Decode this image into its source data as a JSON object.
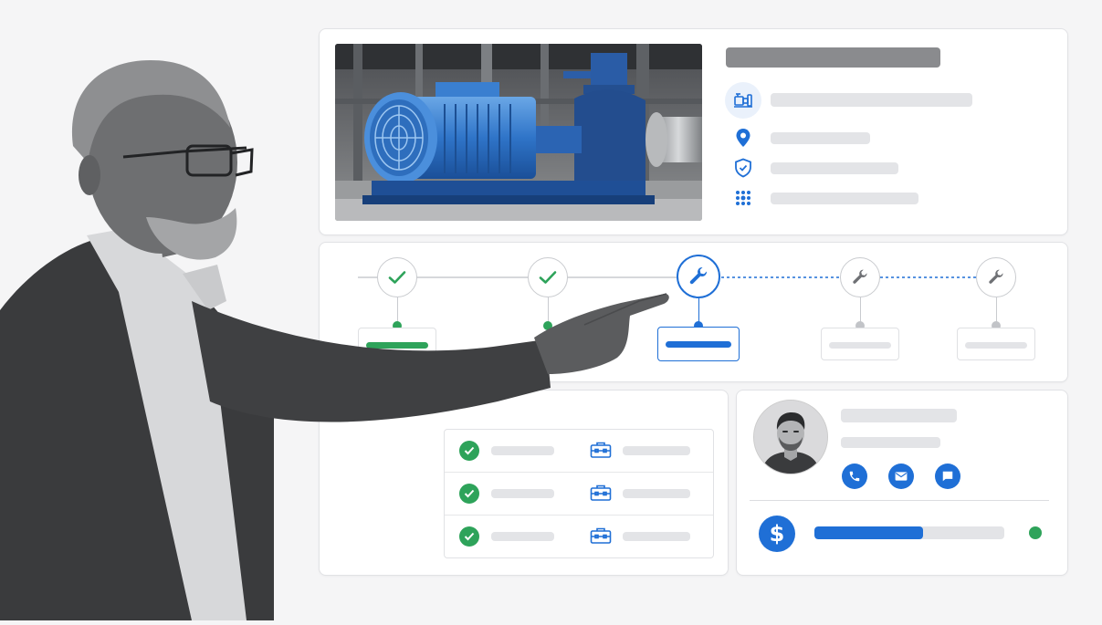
{
  "colors": {
    "accent": "#1f6fd6",
    "success": "#2ea35a",
    "placeholder": "#e3e4e7",
    "heading_placeholder": "#8a8b8e"
  },
  "asset_card": {
    "image": "industrial-pump-photo",
    "detail_icons": [
      "pump-icon",
      "location-pin-icon",
      "shield-check-icon",
      "grid-dots-icon"
    ]
  },
  "workflow": {
    "steps": [
      {
        "icon": "check-icon",
        "status": "completed"
      },
      {
        "icon": "check-icon",
        "status": "completed"
      },
      {
        "icon": "wrench-icon",
        "status": "active"
      },
      {
        "icon": "wrench-icon",
        "status": "pending"
      },
      {
        "icon": "wrench-icon",
        "status": "pending"
      }
    ]
  },
  "tasks": {
    "rows": [
      {
        "status_icon": "check-circle-icon",
        "category_icon": "toolbox-icon"
      },
      {
        "status_icon": "check-circle-icon",
        "category_icon": "toolbox-icon"
      },
      {
        "status_icon": "check-circle-icon",
        "category_icon": "toolbox-icon"
      }
    ]
  },
  "contact": {
    "avatar": "technician-avatar",
    "actions": [
      "phone-icon",
      "email-icon",
      "chat-icon"
    ],
    "budget_icon": "dollar-icon",
    "budget_progress": 0.57,
    "status_color": "#2ea35a"
  },
  "presenter": "presenter-photo"
}
